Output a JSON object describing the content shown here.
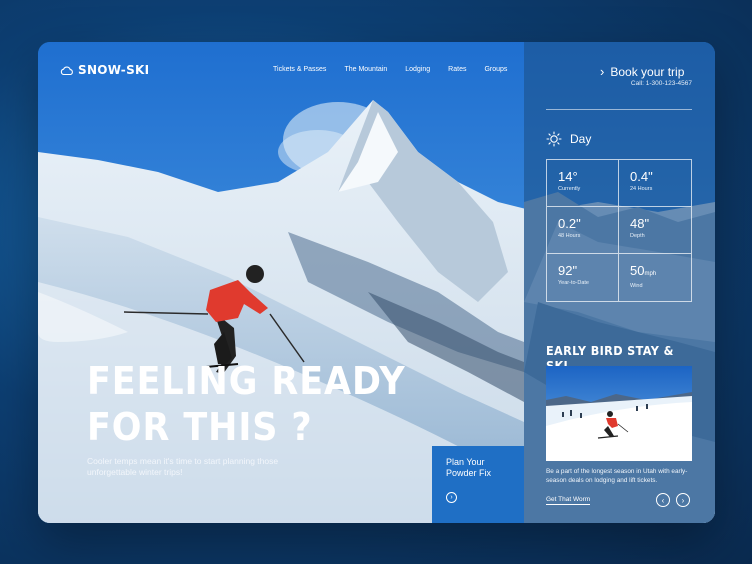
{
  "brand": {
    "name": "SNOW-SKI",
    "icon": "cloud-icon"
  },
  "nav": {
    "items": [
      {
        "label": "Tickets & Passes"
      },
      {
        "label": "The Mountain"
      },
      {
        "label": "Lodging"
      },
      {
        "label": "Rates"
      },
      {
        "label": "Groups"
      }
    ]
  },
  "hero": {
    "headline_line1": "FEELING READY",
    "headline_line2": "FOR THIS ?",
    "subtext": "Cooler temps mean it's time to start planning those unforgettable winter trips!"
  },
  "powder_card": {
    "title": "Plan Your Powder Fix",
    "icon": "chevron-right-icon"
  },
  "booking": {
    "label": "Book your trip",
    "call": "Call: 1-300-123-4567",
    "icon": "chevron-right-icon"
  },
  "weather": {
    "title": "Day",
    "icon": "sun-icon",
    "stats": [
      {
        "value": "14°",
        "unit": "",
        "label": "Currently"
      },
      {
        "value": "0.4\"",
        "unit": "",
        "label": "24 Hours"
      },
      {
        "value": "0.2\"",
        "unit": "",
        "label": "48 Hours"
      },
      {
        "value": "48\"",
        "unit": "",
        "label": "Depth"
      },
      {
        "value": "92\"",
        "unit": "",
        "label": "Year-to-Date"
      },
      {
        "value": "50",
        "unit": "mph",
        "label": "Wind"
      }
    ]
  },
  "early_bird": {
    "title": "EARLY BIRD STAY & SKI",
    "description": "Be a part of the longest season in Utah with early-season deals on lodging and lift tickets.",
    "link": "Get That Worm",
    "prev_icon": "chevron-left-icon",
    "next_icon": "chevron-right-icon"
  },
  "colors": {
    "accent": "#1f6fc5",
    "panel": "#1c528c",
    "sky": "#2b7fd0"
  }
}
